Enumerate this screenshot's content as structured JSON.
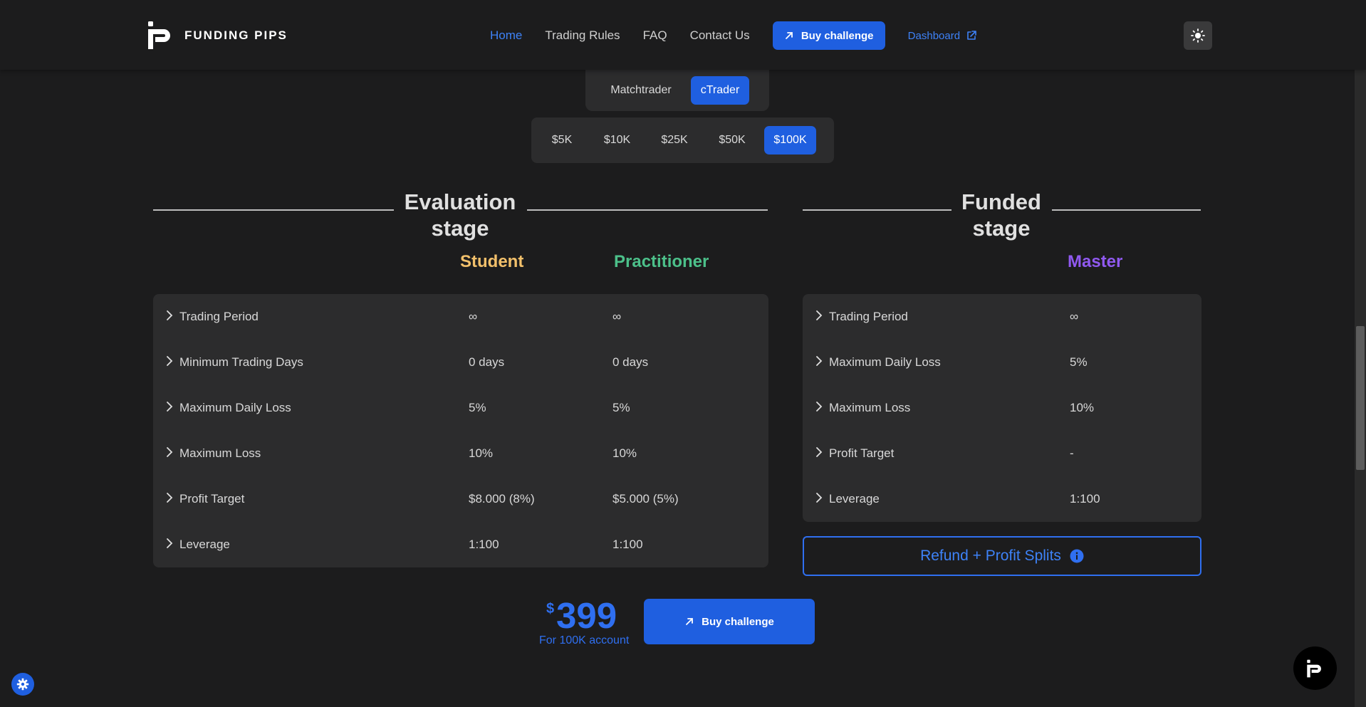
{
  "brand": {
    "name": "FUNDING PIPS",
    "logo_icon": "funding-pips-logo"
  },
  "nav": {
    "links": [
      "Home",
      "Trading Rules",
      "FAQ",
      "Contact Us"
    ],
    "active": "Home",
    "buy_label": "Buy challenge",
    "dashboard_label": "Dashboard"
  },
  "platforms": {
    "options": [
      "Matchtrader",
      "cTrader"
    ],
    "selected": "cTrader"
  },
  "account_sizes": {
    "options": [
      "$5K",
      "$10K",
      "$25K",
      "$50K",
      "$100K"
    ],
    "selected": "$100K"
  },
  "evaluation": {
    "title": "Evaluation stage",
    "tiers": [
      "Student",
      "Practitioner"
    ],
    "rows": [
      {
        "label": "Trading Period",
        "student": "∞",
        "practitioner": "∞"
      },
      {
        "label": "Minimum Trading Days",
        "student": "0 days",
        "practitioner": "0 days"
      },
      {
        "label": "Maximum Daily Loss",
        "student": "5%",
        "practitioner": "5%"
      },
      {
        "label": "Maximum Loss",
        "student": "10%",
        "practitioner": "10%"
      },
      {
        "label": "Profit Target",
        "student": "$8.000 (8%)",
        "practitioner": "$5.000 (5%)"
      },
      {
        "label": "Leverage",
        "student": "1:100",
        "practitioner": "1:100"
      }
    ]
  },
  "funded": {
    "title": "Funded stage",
    "tiers": [
      "Master"
    ],
    "rows": [
      {
        "label": "Trading Period",
        "master": "∞"
      },
      {
        "label": "Maximum Daily Loss",
        "master": "5%"
      },
      {
        "label": "Maximum Loss",
        "master": "10%"
      },
      {
        "label": "Profit Target",
        "master": "-"
      },
      {
        "label": "Leverage",
        "master": "1:100"
      }
    ],
    "refund_label": "Refund + Profit Splits"
  },
  "pricing": {
    "currency": "$",
    "amount": "399",
    "subtitle": "For 100K account",
    "buy_label": "Buy challenge"
  },
  "colors": {
    "accent": "#1f5fe0",
    "student": "#f2c06b",
    "practitioner": "#4cc08a",
    "master": "#9059f0",
    "background": "#1c1c1d",
    "panel": "#2c2c2d"
  }
}
